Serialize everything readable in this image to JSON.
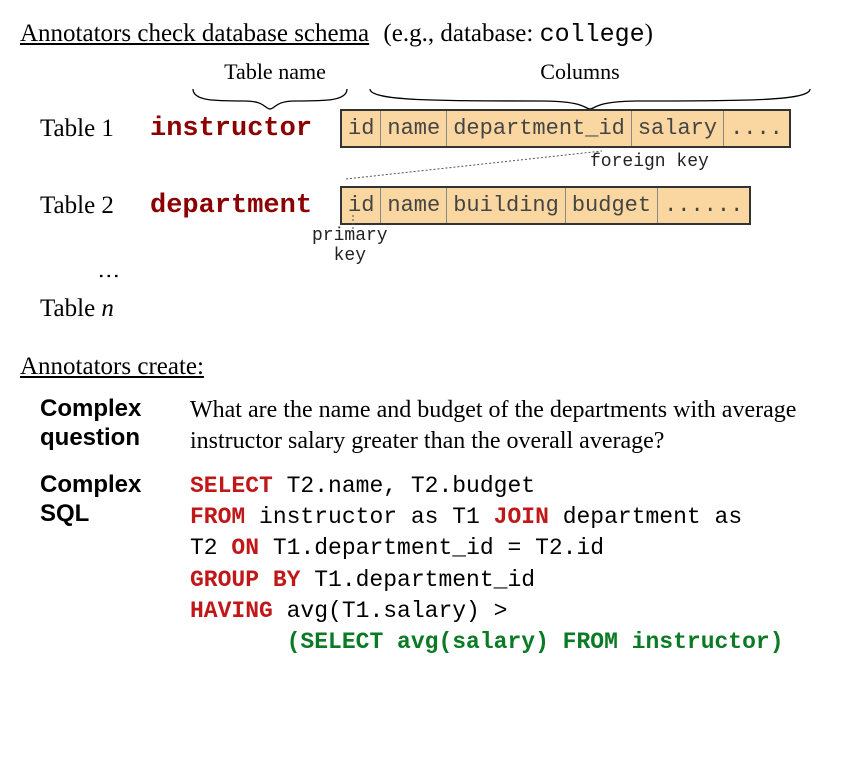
{
  "header": {
    "title": "Annotators check database schema",
    "example_prefix": "(e.g., database: ",
    "example_db": "college",
    "example_suffix": ")"
  },
  "brace_labels": {
    "table_name": "Table name",
    "columns": "Columns"
  },
  "tables": {
    "label1": "Table 1",
    "name1": "instructor",
    "cols1": [
      "id",
      "name",
      "department_id",
      "salary",
      "...."
    ],
    "label2": "Table 2",
    "name2": "department",
    "cols2": [
      "id",
      "name",
      "building",
      "budget",
      "......"
    ],
    "labeln_prefix": "Table ",
    "labeln_var": "n"
  },
  "annotations": {
    "foreign_key": "foreign key",
    "primary_key": "primary\nkey"
  },
  "create": {
    "heading": "Annotators create:",
    "cq_label": "Complex\nquestion",
    "question": "What are the name and budget of the departments with average instructor salary greater than the overall average?",
    "cs_label": "Complex\nSQL",
    "sql": {
      "kw_select": "SELECT",
      "part1": " T2.name, T2.budget",
      "kw_from": "FROM",
      "part2": " instructor as T1 ",
      "kw_join": "JOIN",
      "part3": " department as",
      "part4": "T2 ",
      "kw_on": "ON",
      "part5": " T1.department_id = T2.id",
      "kw_group": "GROUP BY",
      "part6": " T1.department_id",
      "kw_having": "HAVING",
      "part7": " avg(T1.salary) >",
      "sub_pad": "       ",
      "sub": "(SELECT avg(salary) FROM instructor)"
    }
  }
}
